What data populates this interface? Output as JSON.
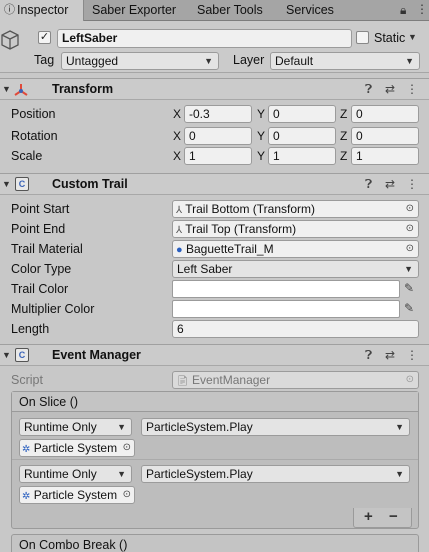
{
  "tabs": [
    {
      "label": "Inspector"
    },
    {
      "label": "Saber Exporter"
    },
    {
      "label": "Saber Tools"
    },
    {
      "label": "Services"
    }
  ],
  "gameobject": {
    "name": "LeftSaber",
    "static_label": "Static",
    "tag_label": "Tag",
    "tag_value": "Untagged",
    "layer_label": "Layer",
    "layer_value": "Default"
  },
  "transform": {
    "title": "Transform",
    "rows": [
      {
        "label": "Position",
        "x": "-0.3",
        "y": "0",
        "z": "0"
      },
      {
        "label": "Rotation",
        "x": "0",
        "y": "0",
        "z": "0"
      },
      {
        "label": "Scale",
        "x": "1",
        "y": "1",
        "z": "1"
      }
    ],
    "axis": {
      "x": "X",
      "y": "Y",
      "z": "Z"
    }
  },
  "custom_trail": {
    "title": "Custom Trail",
    "point_start_label": "Point Start",
    "point_start_value": "Trail Bottom (Transform)",
    "point_end_label": "Point End",
    "point_end_value": "Trail Top (Transform)",
    "trail_material_label": "Trail Material",
    "trail_material_value": "BaguetteTrail_M",
    "color_type_label": "Color Type",
    "color_type_value": "Left Saber",
    "trail_color_label": "Trail Color",
    "multiplier_color_label": "Multiplier Color",
    "length_label": "Length",
    "length_value": "6"
  },
  "event_manager": {
    "title": "Event Manager",
    "script_label": "Script",
    "script_value": "EventManager",
    "on_slice": {
      "title": "On Slice ()",
      "entries": [
        {
          "mode": "Runtime Only",
          "function": "ParticleSystem.Play",
          "target": "Particle System"
        },
        {
          "mode": "Runtime Only",
          "function": "ParticleSystem.Play",
          "target": "Particle System"
        }
      ],
      "add_label": "+",
      "remove_label": "−"
    },
    "on_combo_break_title": "On Combo Break ()"
  },
  "colors": {
    "bg": "#c8c8c8",
    "header": "#cbcbcb",
    "field": "#f0f0f0",
    "accent_blue": "#3a63b8",
    "transform_icon": "#e04a3a"
  }
}
